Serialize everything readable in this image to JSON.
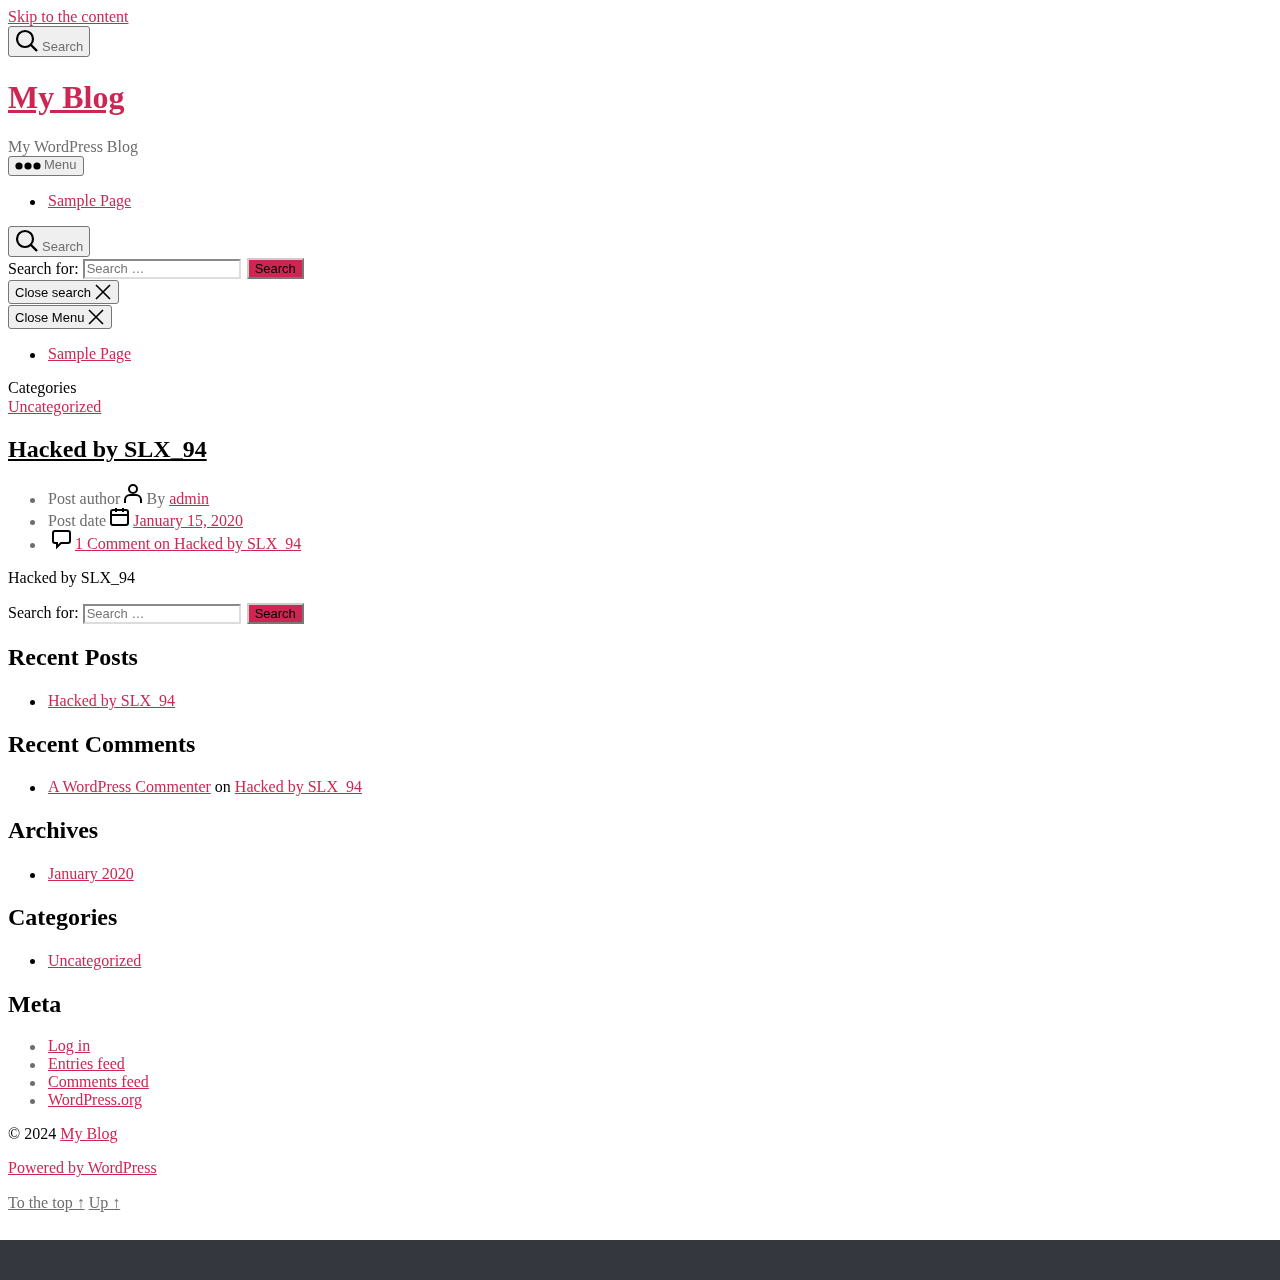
{
  "skip_link": "Skip to the content",
  "header": {
    "search_button": "Search",
    "site_title": "My Blog",
    "tagline": "My WordPress Blog",
    "menu_button": "Menu",
    "nav": [
      "Sample Page"
    ]
  },
  "search_modal": {
    "toggle": "Search",
    "label": "Search for:",
    "placeholder": "Search …",
    "submit": "Search",
    "close": "Close search"
  },
  "menu_modal": {
    "close": "Close Menu",
    "nav": [
      "Sample Page"
    ]
  },
  "post": {
    "categories_label": "Categories",
    "categories": [
      "Uncategorized"
    ],
    "title": "Hacked by SLX_94",
    "meta": [
      {
        "kind": "author",
        "label": "Post author",
        "prefix": "By",
        "link": "admin"
      },
      {
        "kind": "date",
        "label": "Post date",
        "link": "January 15, 2020"
      },
      {
        "kind": "comments",
        "link": "1 Comment on Hacked by SLX_94"
      }
    ],
    "body": "Hacked by SLX_94"
  },
  "widget_search": {
    "label": "Search for:",
    "placeholder": "Search …",
    "submit": "Search"
  },
  "widgets": [
    {
      "title": "Recent Posts",
      "items": [
        [
          {
            "text": "Hacked by SLX_94",
            "link": true
          }
        ]
      ]
    },
    {
      "title": "Recent Comments",
      "items": [
        [
          {
            "text": "A WordPress Commenter",
            "link": true
          },
          {
            "text": "on",
            "link": false
          },
          {
            "text": "Hacked by SLX_94",
            "link": true
          }
        ]
      ]
    },
    {
      "title": "Archives",
      "items": [
        [
          {
            "text": "January 2020",
            "link": true
          }
        ]
      ]
    },
    {
      "title": "Categories",
      "items": [
        [
          {
            "text": "Uncategorized",
            "link": true
          }
        ]
      ]
    },
    {
      "title": "Meta",
      "items": [
        [
          {
            "text": "Log in",
            "link": true
          }
        ],
        [
          {
            "text": "Entries feed",
            "link": true
          }
        ],
        [
          {
            "text": "Comments feed",
            "link": true
          }
        ],
        [
          {
            "text": "WordPress.org",
            "link": true
          }
        ]
      ]
    }
  ],
  "footer": {
    "copyright": "© 2024",
    "site_link": "My Blog",
    "powered": "Powered by WordPress",
    "to_top": "To the top ↑",
    "up": "Up ↑"
  }
}
